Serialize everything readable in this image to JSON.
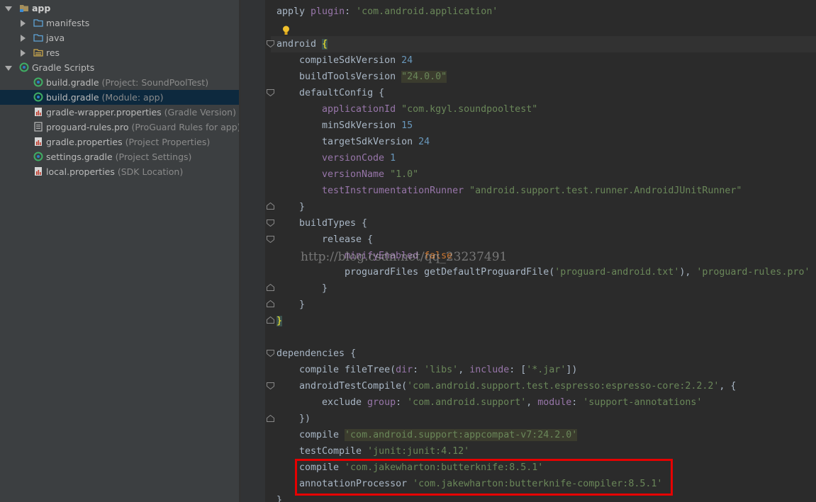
{
  "project_tree": {
    "items": [
      {
        "label": "app",
        "hint": "",
        "icon": "module-folder-icon"
      },
      {
        "label": "manifests",
        "hint": "",
        "icon": "folder-icon"
      },
      {
        "label": "java",
        "hint": "",
        "icon": "folder-icon"
      },
      {
        "label": "res",
        "hint": "",
        "icon": "resource-folder-icon"
      },
      {
        "label": "Gradle Scripts",
        "hint": "",
        "icon": "gradle-icon"
      },
      {
        "label": "build.gradle",
        "hint": "(Project: SoundPoolTest)",
        "icon": "gradle-file-icon"
      },
      {
        "label": "build.gradle",
        "hint": "(Module: app)",
        "icon": "gradle-file-icon"
      },
      {
        "label": "gradle-wrapper.properties",
        "hint": "(Gradle Version)",
        "icon": "properties-file-icon"
      },
      {
        "label": "proguard-rules.pro",
        "hint": "(ProGuard Rules for app)",
        "icon": "text-file-icon"
      },
      {
        "label": "gradle.properties",
        "hint": "(Project Properties)",
        "icon": "properties-file-icon"
      },
      {
        "label": "settings.gradle",
        "hint": "(Project Settings)",
        "icon": "gradle-file-icon"
      },
      {
        "label": "local.properties",
        "hint": "(SDK Location)",
        "icon": "properties-file-icon"
      }
    ],
    "selected_index": 6
  },
  "editor": {
    "watermark": "http://blog.csdn.net/qq_23237491",
    "lines": {
      "l1": {
        "a": "apply ",
        "b": "plugin",
        "c": ": ",
        "d": "'com.android.application'"
      },
      "l2": {
        "a": "android ",
        "b": "{"
      },
      "l3": {
        "a": "compileSdkVersion ",
        "b": "24"
      },
      "l4": {
        "a": "buildToolsVersion ",
        "b": "\"24.0.0\""
      },
      "l5": {
        "a": "defaultConfig {"
      },
      "l6": {
        "a": "applicationId ",
        "b": "\"com.kgyl.soundpooltest\""
      },
      "l7": {
        "a": "minSdkVersion ",
        "b": "15"
      },
      "l8": {
        "a": "targetSdkVersion ",
        "b": "24"
      },
      "l9": {
        "a": "versionCode ",
        "b": "1"
      },
      "l10": {
        "a": "versionName ",
        "b": "\"1.0\""
      },
      "l11": {
        "a": "testInstrumentationRunner ",
        "b": "\"android.support.test.runner.AndroidJUnitRunner\""
      },
      "l12": {
        "a": "}"
      },
      "l13": {
        "a": "buildTypes {"
      },
      "l14": {
        "a": "release {"
      },
      "l15": {
        "a": "minifyEnabled ",
        "b": "false"
      },
      "l16": {
        "a": "proguardFiles getDefaultProguardFile(",
        "b": "'proguard-android.txt'",
        "c": "), ",
        "d": "'proguard-rules.pro'"
      },
      "l17": {
        "a": "}"
      },
      "l18": {
        "a": "}"
      },
      "l19": {
        "a": "}"
      },
      "l20": {
        "a": "dependencies {"
      },
      "l21": {
        "a": "compile fileTree(",
        "b": "dir",
        "c": ": ",
        "d": "'libs'",
        "e": ", ",
        "f": "include",
        "g": ": [",
        "h": "'*.jar'",
        "i": "])"
      },
      "l22": {
        "a": "androidTestCompile(",
        "b": "'com.android.support.test.espresso:espresso-core:2.2.2'",
        "c": ", {"
      },
      "l23": {
        "a": "exclude ",
        "b": "group",
        "c": ": ",
        "d": "'com.android.support'",
        "e": ", ",
        "f": "module",
        "g": ": ",
        "h": "'support-annotations'"
      },
      "l24": {
        "a": "})"
      },
      "l25": {
        "a": "compile ",
        "b": "'com.android.support:appcompat-v7:24.2.0'"
      },
      "l26": {
        "a": "testCompile ",
        "b": "'junit:junit:4.12'"
      },
      "l27": {
        "a": "compile ",
        "b": "'com.jakewharton:butterknife:8.5.1'"
      },
      "l28": {
        "a": "annotationProcessor ",
        "b": "'com.jakewharton:butterknife-compiler:8.5.1'"
      },
      "l29": {
        "a": "}"
      }
    }
  },
  "colors": {
    "tree_bg": "#3c3f41",
    "editor_bg": "#2b2b2b",
    "selection": "#0d293e",
    "string": "#6a8759",
    "number": "#6897bb",
    "property": "#9876aa",
    "keyword": "#cc7832",
    "annotation_box": "#e60000"
  }
}
